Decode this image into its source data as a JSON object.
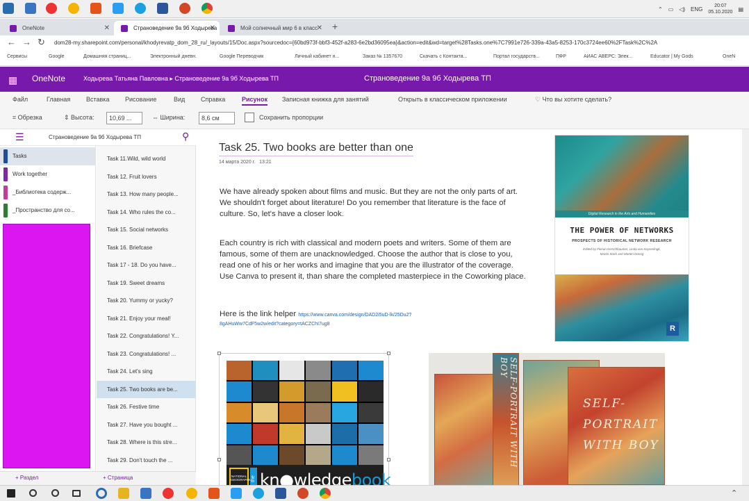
{
  "system": {
    "language": "ENG",
    "clock_time": "20:07",
    "clock_date": "05.10.2020"
  },
  "browser": {
    "tabs": [
      {
        "label": "OneNote",
        "active": false
      },
      {
        "label": "Страноведение 9а 9б Ходырева",
        "active": true
      },
      {
        "label": "Мой солнечный мир 6 в класс",
        "active": false
      }
    ],
    "new_tab": "+",
    "url": "dom28-my.sharepoint.com/personal/khodyrevatp_dom_28_ru/_layouts/15/Doc.aspx?sourcedoc={60bd973f-bbf3-452f-a283-6e2bd36095ea}&action=edit&wd=target%28Tasks.one%7C7991e726-339a-43a5-8253-170c3724ee60%2FTask%2C%2A",
    "bookmarks": [
      "Сервисы",
      "Google",
      "Домашняя страниц...",
      "Электронный дневн.",
      "Google Переводчик",
      "Личный кабинет н...",
      "Заказ № 1357670",
      "Скачать с Контакта...",
      "Портал государств...",
      "ПФР",
      "АИАС АВЕРС: Элек...",
      "Educator | My Gods",
      "OneN"
    ]
  },
  "onenote": {
    "app_name": "OneNote",
    "breadcrumb": "Ходырева Татьяна Павловна  ▸  Страноведение 9а 9б Ходырева ТП",
    "center_title": "Страноведение 9а 9б Ходырева ТП",
    "ribbon_tabs": [
      "Файл",
      "Главная",
      "Вставка",
      "Рисование",
      "Вид",
      "Справка",
      "Рисунок",
      "Записная книжка для занятий",
      "Открыть в классическом приложении",
      "Что вы хотите сделать?"
    ],
    "ribbon_active": "Рисунок",
    "ribbon": {
      "crop": "Обрезка",
      "height_label": "Высота:",
      "height_value": "10,69 ...",
      "width_label": "Ширина:",
      "width_value": "8,6 см",
      "keep_ratio": "Сохранить пропорции"
    },
    "notebook_name": "Страноведение 9а 9б Ходырева ТП",
    "sections": [
      {
        "label": "Tasks",
        "color": "#1e4e9e",
        "active": true
      },
      {
        "label": "Work together",
        "color": "#7a2aa8",
        "active": false
      },
      {
        "label": "_Библиотека содерж...",
        "color": "#c13e96",
        "active": false
      },
      {
        "label": "_Пространство для со...",
        "color": "#2e7d32",
        "active": false
      }
    ],
    "pages": [
      "Task 11.Wild, wild world",
      "Task 12. Fruit lovers",
      "Task 13. How many people...",
      "Task 14. Who rules the co...",
      "Task 15. Social networks",
      "Task 16. Briefcase",
      "Task 17 - 18. Do you have...",
      "Task 19. Sweet dreams",
      "Task 20. Yummy or yucky?",
      "Task 21. Enjoy your meal!",
      "Task 22. Congratulations! Y...",
      "Task 23. Congratulations! ...",
      "Task 24. Let's sing",
      "Task 25. Two books are be...",
      "Task 26. Festive time",
      "Task 27. Have you bought ...",
      "Task 28. Where is this stre...",
      "Task 29. Don't touch the ..."
    ],
    "active_page_index": 13,
    "add_section": "+ Раздел",
    "add_page": "+ Страница"
  },
  "page": {
    "title": "Task  25. Two books are better than one",
    "date": "14 марта 2020 г.",
    "time": "13:21",
    "paragraph1": "We have already spoken about films and music. But they are not the only parts of art. We shouldn't forget about literature! Do you remember that literature is the face of culture. So, let's have a closer look.",
    "paragraph2": "Each country is rich with classical and modern poets and writers. Some of them are famous, some of them are unacknowledged. Choose the author that is close to you, read one of his or her works and imagine that you are the illustrator of the coverage. Use Canva to present it, than share the completed masterpiece in the Coworking place.",
    "link_prefix": "Here is the link helper",
    "link_url": "https://www.canva.com/design/DAD2i5uD-lk/25Du2?8gAHuWw7CdF5w2w/edit?category=tACZChI7ug8"
  },
  "covers": {
    "networks_strip": "Digital Research in the Arts and Humanities",
    "networks_title": "THE POWER OF NETWORKS",
    "networks_subtitle": "PROSPECTS OF HISTORICAL NETWORK RESEARCH",
    "networks_editors": "Edited by Florian Kerschbaumer, Linda von Keyserlingk, Martin Stark and Marten Düring",
    "networks_publisher": "R",
    "knowledge_brand": "NATIONAL GEOGRAPHIC",
    "knowledge_the": "the",
    "knowledge_title_a": "kn",
    "knowledge_title_b": "wledge",
    "knowledge_title_c": "book",
    "self_portrait_spine": "SELF-PORTRAIT WITH BOY",
    "self_portrait_title": "SELF- PORTRAIT WITH BOY"
  }
}
